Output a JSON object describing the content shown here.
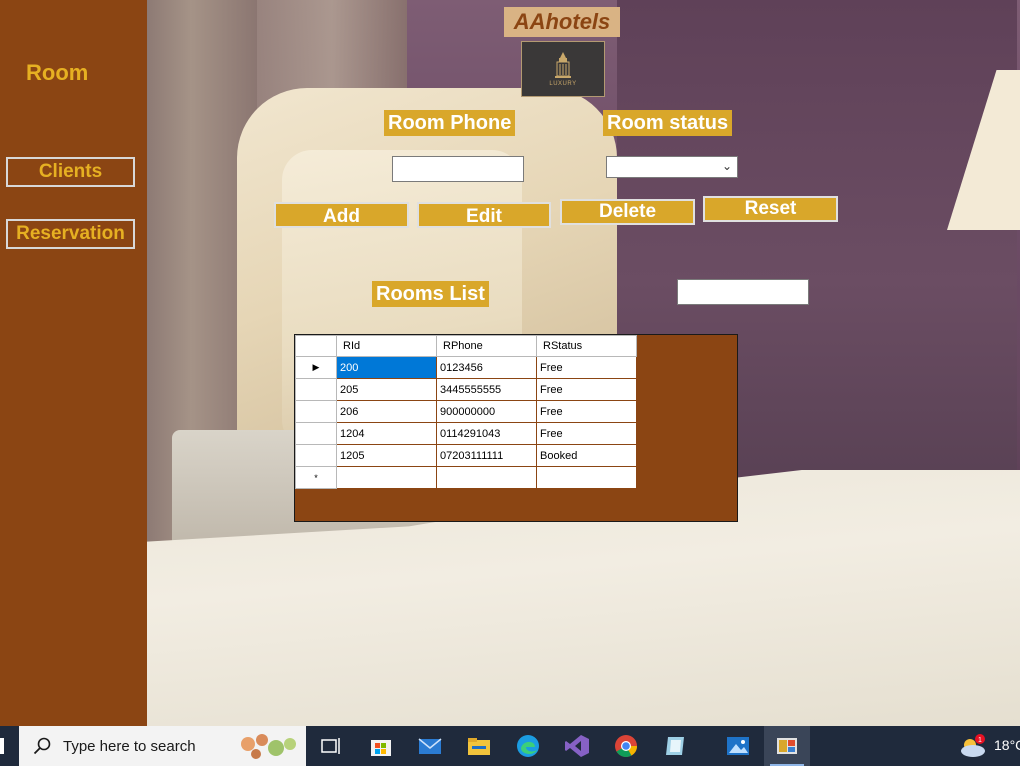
{
  "sidebar": {
    "title": "Room",
    "items": [
      {
        "label": "Clients"
      },
      {
        "label": "Reservation"
      }
    ]
  },
  "header": {
    "brand": "AAhotels",
    "logo_text": "LUXURY"
  },
  "form": {
    "room_phone_label": "Room Phone",
    "room_status_label": "Room status",
    "room_phone_value": "",
    "room_status_value": ""
  },
  "actions": {
    "add": "Add",
    "edit": "Edit",
    "delete": "Delete",
    "reset": "Reset"
  },
  "list": {
    "title": "Rooms List",
    "search_value": "",
    "columns": [
      "RId",
      "RPhone",
      "RStatus"
    ],
    "rows": [
      {
        "rid": "200",
        "rphone": "0123456",
        "rstatus": "Free"
      },
      {
        "rid": "205",
        "rphone": "3445555555",
        "rstatus": "Free"
      },
      {
        "rid": "206",
        "rphone": "900000000",
        "rstatus": "Free"
      },
      {
        "rid": "1204",
        "rphone": "0114291043",
        "rstatus": "Free"
      },
      {
        "rid": "1205",
        "rphone": "07203111111",
        "rstatus": "Booked"
      }
    ],
    "current_row_marker": "▶",
    "new_row_marker": "*"
  },
  "taskbar": {
    "search_placeholder": "Type here to search",
    "temperature": "18°C",
    "weather_badge": "1",
    "apps": [
      "task-view",
      "microsoft-store",
      "mail",
      "file-explorer",
      "edge",
      "visual-studio",
      "chrome",
      "notepad-app",
      "photos",
      "active-app"
    ]
  },
  "colors": {
    "sidebar_bg": "#8b4513",
    "accent_gold": "#d9a72a",
    "sidebar_text": "#e6b022",
    "selection_blue": "#0078d7"
  }
}
